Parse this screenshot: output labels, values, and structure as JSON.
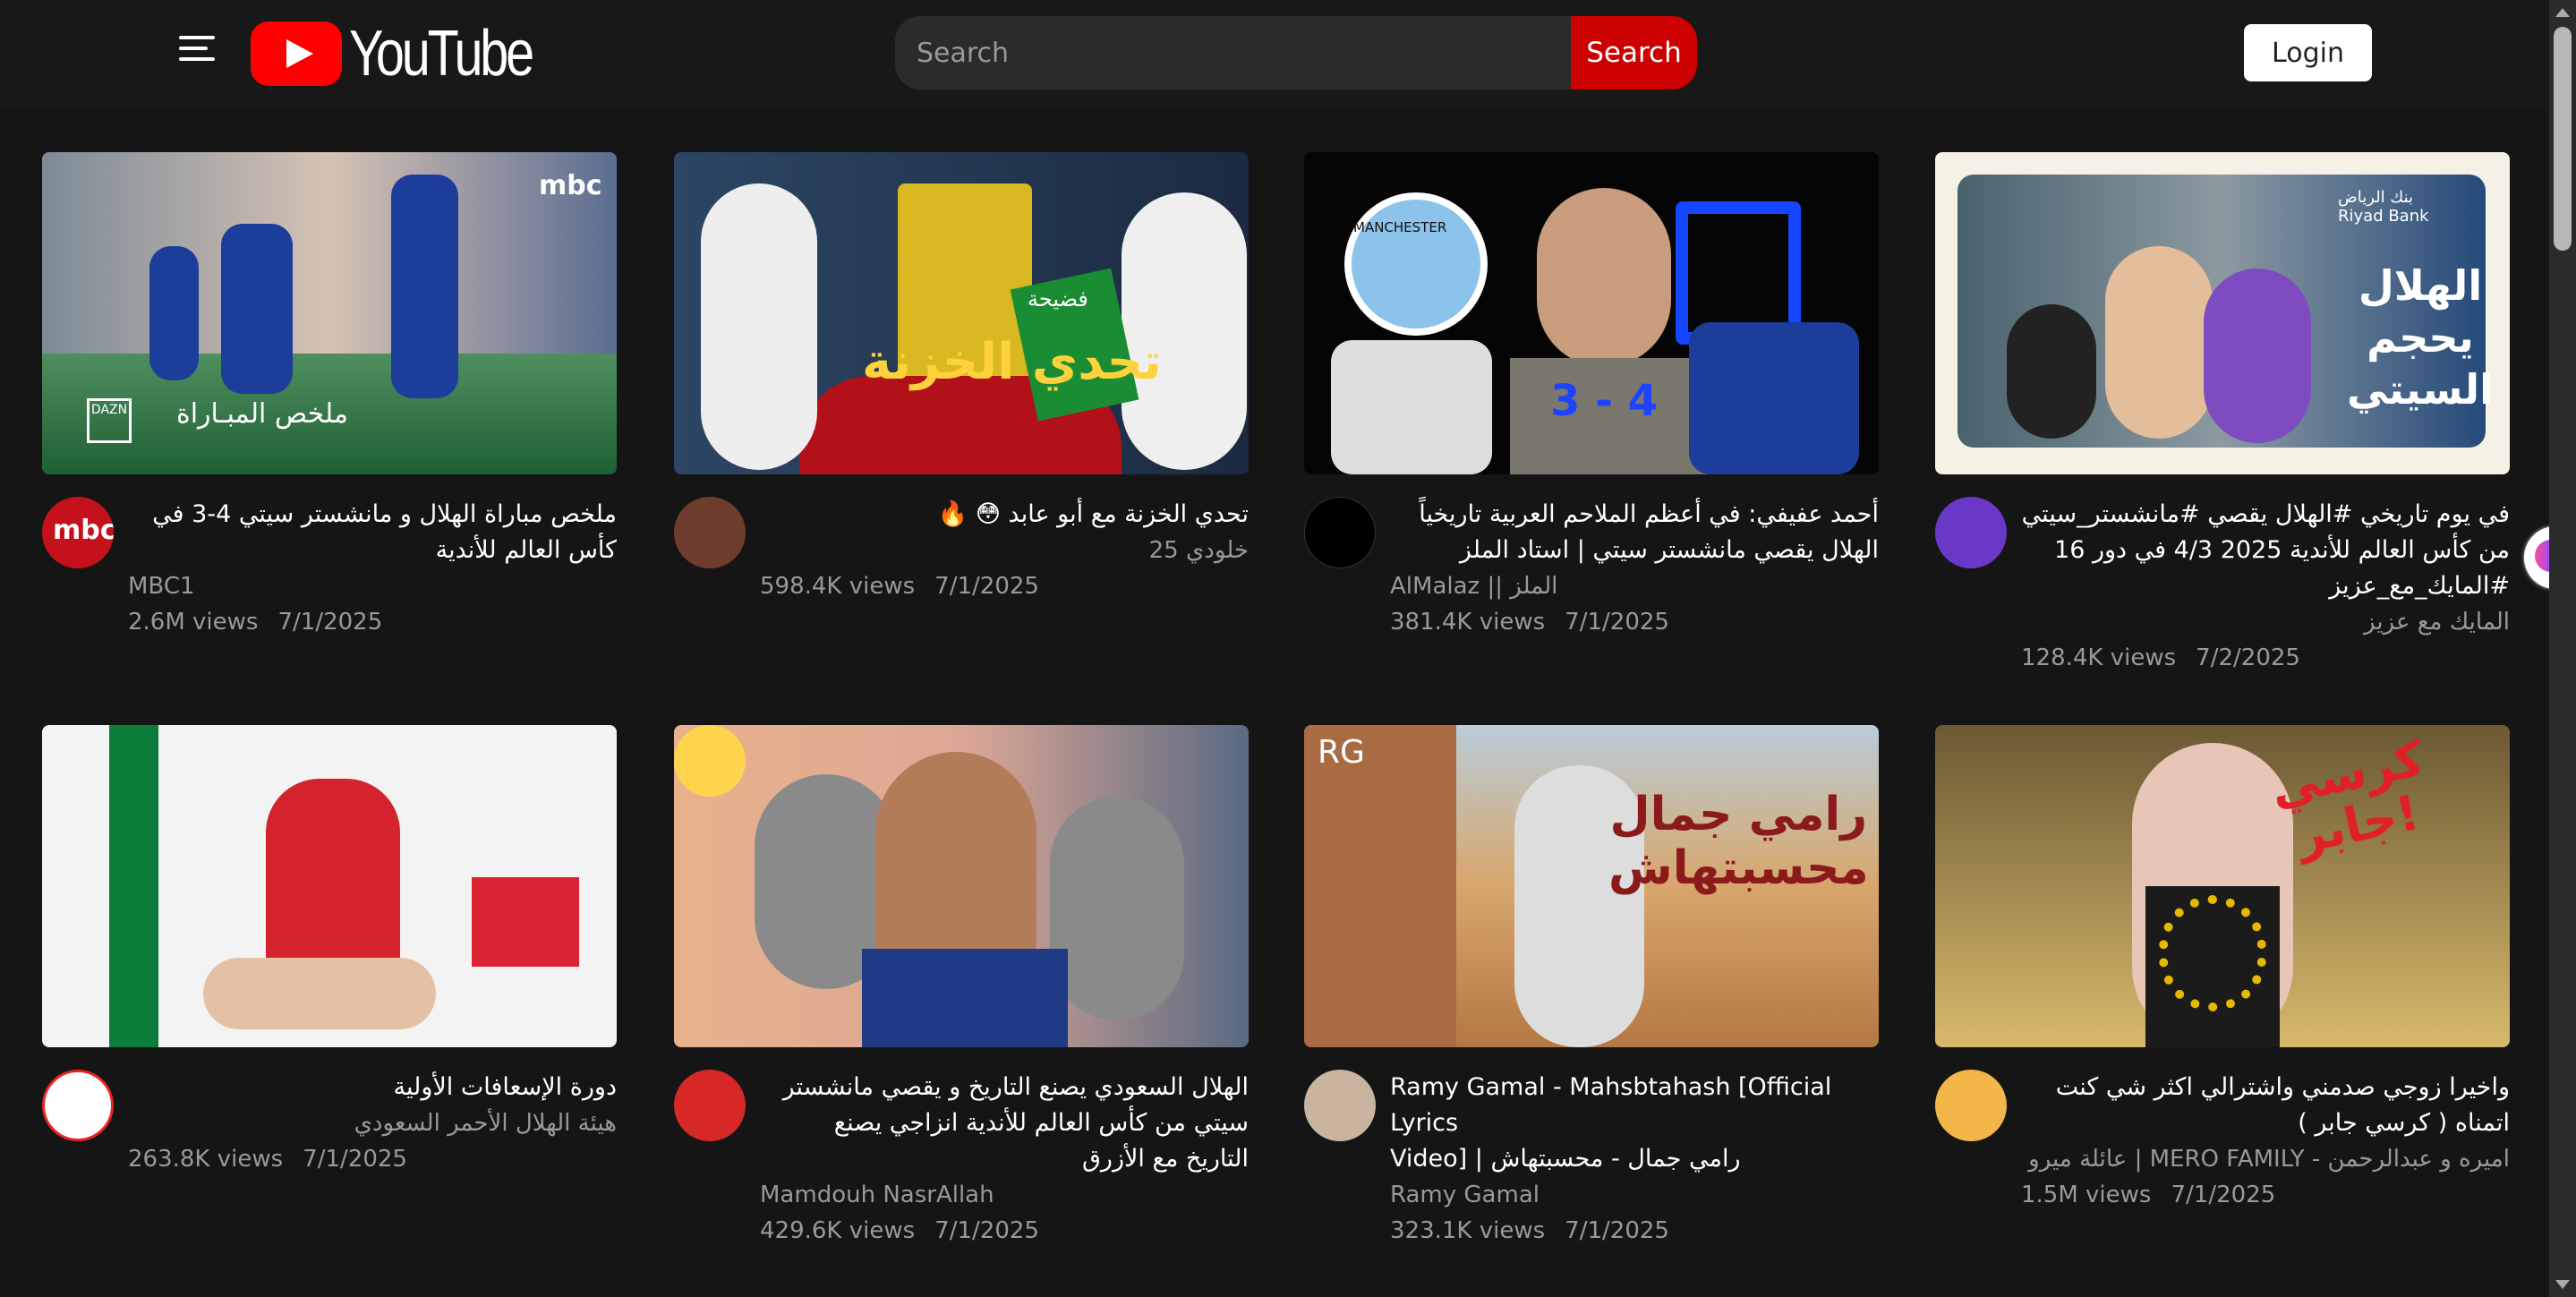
{
  "header": {
    "logo_text": "YouTube",
    "search_placeholder": "Search",
    "search_button": "Search",
    "login_button": "Login"
  },
  "colors": {
    "background": "#151515",
    "topbar": "#181818",
    "search_button": "#cc0000",
    "youtube_red": "#ff0000",
    "secondary_text": "#999999"
  },
  "icons": {
    "menu": "menu-icon",
    "youtube": "youtube-play-icon",
    "side_extension": "brain-icon"
  },
  "videos": [
    {
      "title": "ملخص مباراة الهلال و مانشستر سيتي 4-3 في\nكأس العالم للأندية",
      "channel": "MBC1",
      "views": "2.6M views",
      "date": "7/1/2025",
      "avatar_text": "mbc"
    },
    {
      "title": "تحدي الخزنة مع أبو عابد 😳 🔥",
      "channel": "خلودي 25",
      "views": "598.4K views",
      "date": "7/1/2025"
    },
    {
      "title": "أحمد عفيفي: في أعظم الملاحم العربية تاريخياً\nالهلال يقصي مانشستر سيتي | استاد الملز",
      "channel": "AlMalaz || الملز",
      "views": "381.4K views",
      "date": "7/1/2025"
    },
    {
      "title": "في يوم تاريخي #الهلال يقصي #مانشستر_سيتي\nمن كأس العالم للأندية 2025 4/3 في دور 16\n#المايك_مع_عزيز",
      "channel": "المايك مع عزيز",
      "views": "128.4K views",
      "date": "7/2/2025"
    },
    {
      "title": "دورة الإسعافات الأولية",
      "channel": "هيئة الهلال الأحمر السعودي",
      "views": "263.8K views",
      "date": "7/1/2025"
    },
    {
      "title": "الهلال السعودي يصنع التاريخ و يقصي مانشستر\nسيتي من كأس العالم للأندية انزاجي يصنع\nالتاريخ مع الأزرق",
      "channel": "Mamdouh NasrAllah",
      "views": "429.6K views",
      "date": "7/1/2025"
    },
    {
      "title": "Ramy Gamal - Mahsbtahash [Official Lyrics\nVideo] | رامي جمال - محسبتهاش",
      "channel": "Ramy Gamal",
      "views": "323.1K views",
      "date": "7/1/2025"
    },
    {
      "title": "واخيرا زوجي صدمني واشترالي اكثر شي كنت\nاتمناه ( كرسي جابر )",
      "channel": "اميره و عبدالرحمن - MERO FAMILY | عائلة ميرو",
      "views": "1.5M views",
      "date": "7/1/2025"
    }
  ],
  "thumbnail_texts": {
    "mbc_watermark": "mbc",
    "summary": "ملخص المبـاراة",
    "dazn": "DAZN",
    "vault_title": "تحدي الخزنة",
    "vault_badge": "فضيحة",
    "manchester": "MANCHESTER",
    "score": "3 - 4",
    "riyad_bank": "بنك الرياض\nRiyad Bank",
    "hilal_title": "الهلال\nيحجم\nالسيتي",
    "ramy_title": "رامي جمال\nمحسبتهاش",
    "rg": "RG",
    "chair": "كرسي\nجابر!"
  }
}
